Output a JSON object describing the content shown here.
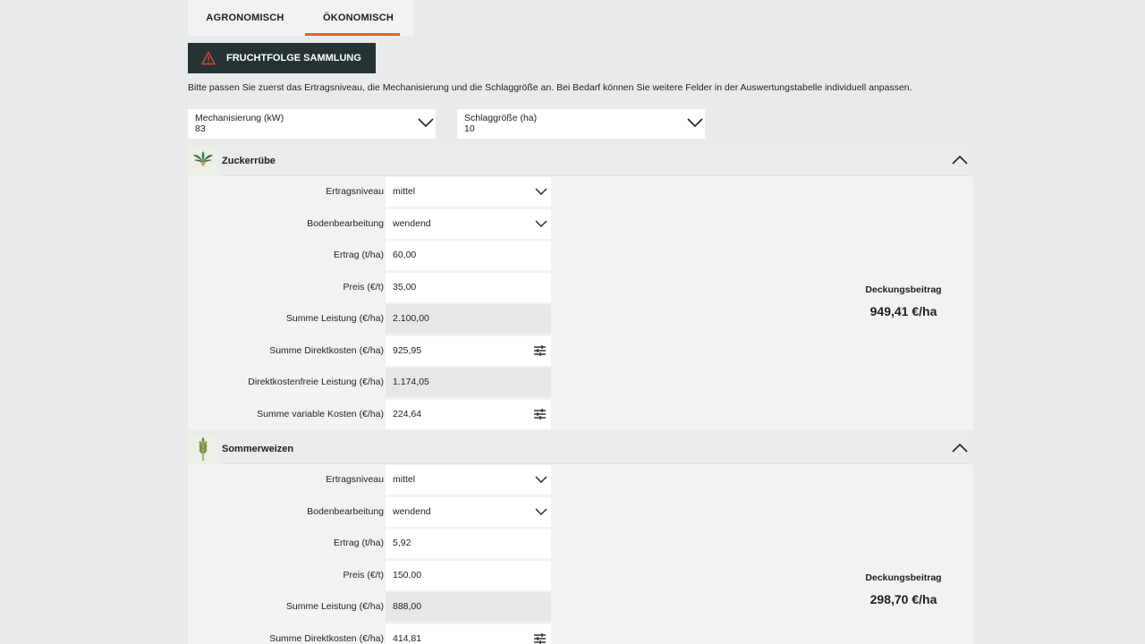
{
  "tabs": [
    {
      "label": "AGRONOMISCH",
      "active": false
    },
    {
      "label": "ÖKONOMISCH",
      "active": true
    }
  ],
  "collection_button": {
    "label": "FRUCHTFOLGE SAMMLUNG",
    "icon": "warning-icon"
  },
  "intro_text": "Bitte passen Sie zuerst das Ertragsniveau, die Mechanisierung und die Schlaggröße an. Bei Bedarf können Sie weitere Felder in der Auswertungstabelle individuell anpassen.",
  "mechanization": {
    "label": "Mechanisierung (kW)",
    "value": "83"
  },
  "field_size": {
    "label": "Schlaggröße (ha)",
    "value": "10"
  },
  "crops": [
    {
      "name": "Zuckerrübe",
      "icon": "sugar-beet-icon",
      "rows": [
        {
          "label": "Ertragsniveau",
          "value": "mittel"
        },
        {
          "label": "Bodenbearbeitung",
          "value": "wendend"
        },
        {
          "label": "Ertrag (t/ha)",
          "value": "60,00"
        },
        {
          "label": "Preis (€/t)",
          "value": "35,00"
        },
        {
          "label": "Summe Leistung (€/ha)",
          "value": "2.100,00"
        },
        {
          "label": "Summe Direktkosten (€/ha)",
          "value": "925,95"
        },
        {
          "label": "Direktkostenfreie Leistung (€/ha)",
          "value": "1.174,05"
        },
        {
          "label": "Summe variable Kosten (€/ha)",
          "value": "224,64"
        }
      ],
      "result": {
        "title": "Deckungsbeitrag",
        "value": "949,41 €/ha"
      }
    },
    {
      "name": "Sommerweizen",
      "icon": "wheat-icon",
      "rows": [
        {
          "label": "Ertragsniveau",
          "value": "mittel"
        },
        {
          "label": "Bodenbearbeitung",
          "value": "wendend"
        },
        {
          "label": "Ertrag (t/ha)",
          "value": "5,92"
        },
        {
          "label": "Preis (€/t)",
          "value": "150,00"
        },
        {
          "label": "Summe Leistung (€/ha)",
          "value": "888,00"
        },
        {
          "label": "Summe Direktkosten (€/ha)",
          "value": "414,81"
        }
      ],
      "result": {
        "title": "Deckungsbeitrag",
        "value": "298,70 €/ha"
      }
    }
  ],
  "colors": {
    "accent": "#e2661e",
    "button_bg": "#253334",
    "page_bg": "#e8eaeb"
  }
}
